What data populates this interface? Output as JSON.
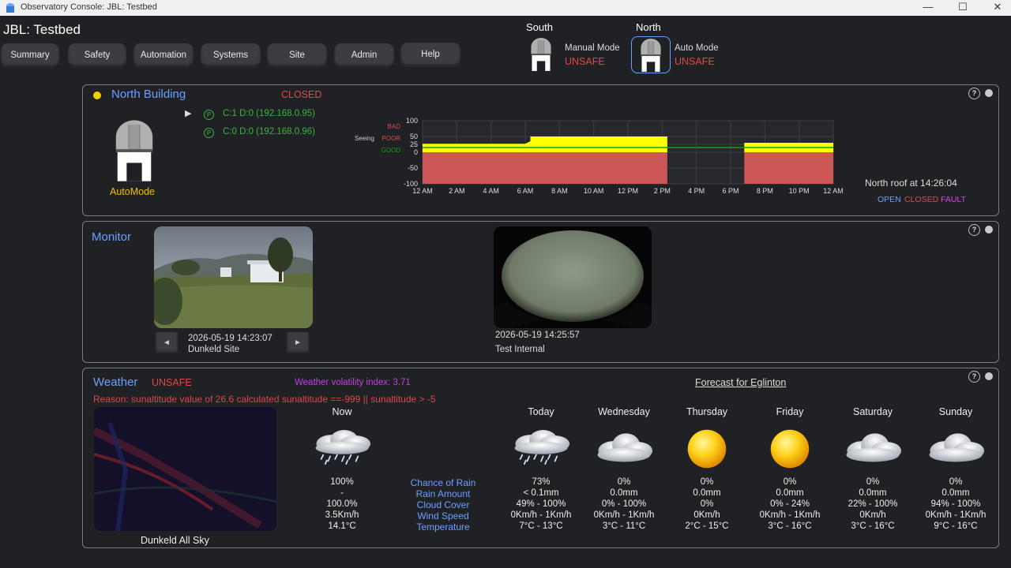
{
  "window": {
    "title": "Observatory Console: JBL: Testbed",
    "minimize": "—",
    "maximize": "☐",
    "close": "✕"
  },
  "app_title": "JBL: Testbed",
  "nav": [
    "Summary",
    "Safety",
    "Automation",
    "Systems",
    "Site",
    "Admin",
    "Help"
  ],
  "domes": {
    "south": {
      "name": "South",
      "mode": "Manual Mode",
      "status": "UNSAFE"
    },
    "north": {
      "name": "North",
      "mode": "Auto Mode",
      "status": "UNSAFE"
    }
  },
  "north_building": {
    "title": "North Building",
    "state": "CLOSED",
    "mode_label": "AutoMode",
    "indicator_color": "#f0d000",
    "connections": [
      {
        "icon": "P",
        "text": "C:1 D:0 (192.168.0.95)"
      },
      {
        "icon": "P",
        "text": "C:0 D:0 (192.168.0.96)"
      }
    ],
    "roof_text": "North roof at  14:26:04",
    "legend": {
      "open": "OPEN",
      "closed": "CLOSED",
      "fault": "FAULT"
    }
  },
  "chart_data": {
    "type": "area",
    "ylabel": "Seeing",
    "ylim": [
      -100,
      100
    ],
    "yticks": [
      100,
      50,
      25,
      0,
      -50,
      -100
    ],
    "ytick_labels": [
      "100",
      "50",
      "25",
      "0",
      "-50",
      "-100"
    ],
    "side_labels": [
      "BAD",
      "POOR",
      "GOOD"
    ],
    "x_range_hours": [
      0,
      24
    ],
    "xticks": [
      "12 AM",
      "2 AM",
      "4 AM",
      "6 AM",
      "8 AM",
      "10 AM",
      "12 PM",
      "2 PM",
      "4 PM",
      "6 PM",
      "8 PM",
      "10 PM",
      "12 AM"
    ],
    "series": [
      {
        "color": "#ffff00",
        "points": [
          [
            0,
            27
          ],
          [
            6,
            27
          ],
          [
            6.3,
            35
          ],
          [
            6.3,
            50
          ],
          [
            14.3,
            50
          ],
          [
            14.3,
            null
          ],
          [
            18.8,
            null
          ],
          [
            18.8,
            30
          ],
          [
            24,
            30
          ]
        ]
      },
      {
        "color": "#cc5555",
        "points": [
          [
            0,
            -100
          ],
          [
            14.3,
            -100
          ],
          [
            14.3,
            null
          ],
          [
            18.8,
            null
          ],
          [
            18.8,
            -100
          ],
          [
            24,
            -100
          ]
        ]
      },
      {
        "color": "#1a9a1a",
        "points": [
          [
            0,
            15
          ],
          [
            24,
            15
          ]
        ]
      }
    ],
    "gap_hours": [
      14.3,
      18.8
    ]
  },
  "monitor": {
    "title": "Monitor",
    "cameras": [
      {
        "time": "2026-05-19 14:23:07",
        "name": "Dunkeld Site",
        "prev": "◄",
        "next": "►"
      },
      {
        "time": "2026-05-19 14:25:57",
        "name": "Test Internal"
      }
    ]
  },
  "weather": {
    "title": "Weather",
    "status": "UNSAFE",
    "volatility": "Weather volatility index: 3.71",
    "forecast_title": "Forecast for Eglinton",
    "reason": "Reason: sunaltitude value of 26.6 calculated sunaltitude ==-999 || sunaltitude > -5",
    "allsky_label": "Dunkeld All Sky",
    "row_labels": [
      "Chance of Rain",
      "Rain Amount",
      "Cloud Cover",
      "Wind Speed",
      "Temperature"
    ],
    "now": {
      "label": "Now",
      "icon": "rain-cloud-icon",
      "values": [
        "100%",
        "-",
        "100.0%",
        "3.5Km/h",
        "14.1°C"
      ]
    },
    "days": [
      {
        "label": "Today",
        "icon": "rain-cloud-icon",
        "values": [
          "73%",
          "< 0.1mm",
          "49% - 100%",
          "0Km/h - 1Km/h",
          "7°C - 13°C"
        ]
      },
      {
        "label": "Wednesday",
        "icon": "cloud-icon",
        "values": [
          "0%",
          "0.0mm",
          "0% - 100%",
          "0Km/h - 1Km/h",
          "3°C - 11°C"
        ]
      },
      {
        "label": "Thursday",
        "icon": "sun-icon",
        "values": [
          "0%",
          "0.0mm",
          "0%",
          "0Km/h",
          "2°C - 15°C"
        ]
      },
      {
        "label": "Friday",
        "icon": "sun-icon",
        "values": [
          "0%",
          "0.0mm",
          "0% - 24%",
          "0Km/h - 1Km/h",
          "3°C - 16°C"
        ]
      },
      {
        "label": "Saturday",
        "icon": "cloud-icon",
        "values": [
          "0%",
          "0.0mm",
          "22% - 100%",
          "0Km/h",
          "3°C - 16°C"
        ]
      },
      {
        "label": "Sunday",
        "icon": "cloud-icon",
        "values": [
          "0%",
          "0.0mm",
          "94% - 100%",
          "0Km/h - 1Km/h",
          "9°C - 16°C"
        ]
      }
    ]
  },
  "colors": {
    "accent_blue": "#6aa0ff",
    "unsafe_red": "#e04848",
    "ok_green": "#3bb33b",
    "panel_border": "#7a7d83",
    "volatility": "#c040e0"
  }
}
